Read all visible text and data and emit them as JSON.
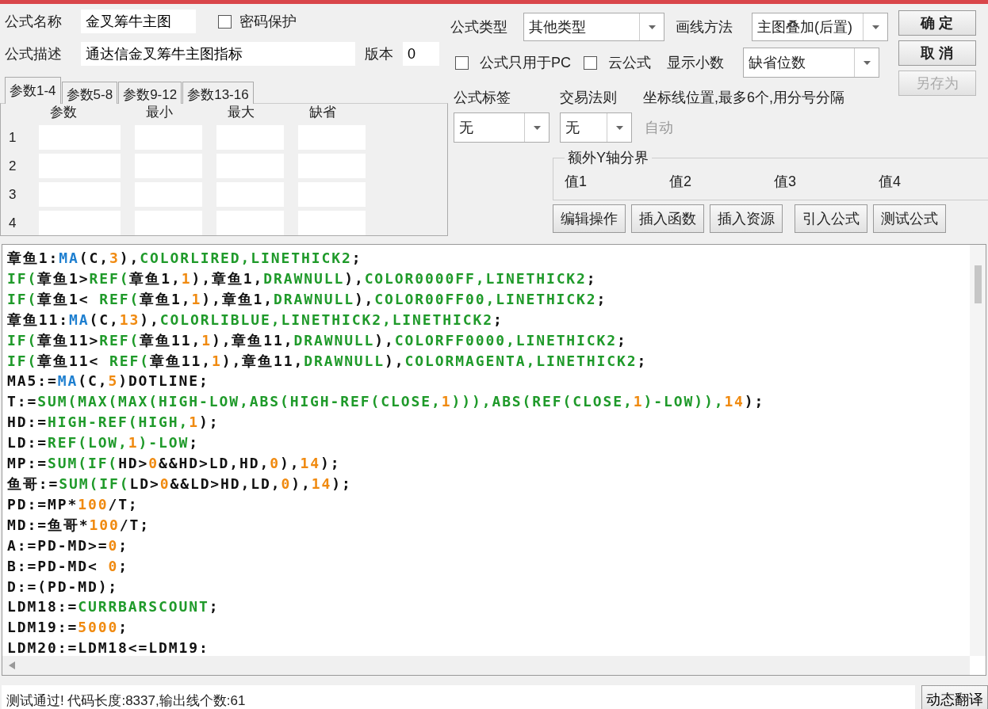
{
  "name_field": {
    "label": "公式名称",
    "value": "金叉筹牛主图"
  },
  "password_protect": {
    "label": "密码保护",
    "checked": false
  },
  "description_field": {
    "label": "公式描述",
    "value": "通达信金叉筹牛主图指标"
  },
  "version_field": {
    "label": "版本",
    "value": "0"
  },
  "param_tabs": [
    {
      "label": "参数1-4",
      "selected": true
    },
    {
      "label": "参数5-8",
      "selected": false
    },
    {
      "label": "参数9-12",
      "selected": false
    },
    {
      "label": "参数13-16",
      "selected": false
    }
  ],
  "param_table": {
    "columns": [
      "参数",
      "最小",
      "最大",
      "缺省"
    ],
    "rows": [
      "1",
      "2",
      "3",
      "4"
    ]
  },
  "formula_type": {
    "label": "公式类型",
    "value": "其他类型"
  },
  "draw_method": {
    "label": "画线方法",
    "value": "主图叠加(后置)"
  },
  "pc_only": {
    "label": "公式只用于PC",
    "checked": false
  },
  "cloud_formula": {
    "label": "云公式",
    "checked": false
  },
  "decimals": {
    "label": "显示小数",
    "value": "缺省位数"
  },
  "dialog_buttons": [
    {
      "label": "确 定",
      "disabled": false
    },
    {
      "label": "取 消",
      "disabled": false
    },
    {
      "label": "另存为",
      "disabled": true
    }
  ],
  "formula_tag": {
    "label": "公式标签",
    "value": "无"
  },
  "trade_rule": {
    "label": "交易法则",
    "value": "无"
  },
  "axis_positions": {
    "label": "坐标线位置,最多6个,用分号分隔",
    "placeholder": "自动"
  },
  "extra_y_axis": {
    "title": "额外Y轴分界",
    "values": [
      "值1",
      "值2",
      "值3",
      "值4"
    ]
  },
  "tool_buttons": [
    "编辑操作",
    "插入函数",
    "插入资源",
    "引入公式",
    "测试公式"
  ],
  "code_lines": [
    [
      {
        "kind": "plain",
        "text": "章鱼1:"
      },
      {
        "kind": "function",
        "text": "MA"
      },
      {
        "kind": "plain",
        "text": "(C,"
      },
      {
        "kind": "number",
        "text": "3"
      },
      {
        "kind": "plain",
        "text": "),"
      },
      {
        "kind": "keyword",
        "text": "COLORLIRED,LINETHICK2"
      },
      {
        "kind": "plain",
        "text": ";"
      }
    ],
    [
      {
        "kind": "keyword",
        "text": "IF("
      },
      {
        "kind": "plain",
        "text": "章鱼1>"
      },
      {
        "kind": "keyword",
        "text": "REF("
      },
      {
        "kind": "plain",
        "text": "章鱼1,"
      },
      {
        "kind": "number",
        "text": "1"
      },
      {
        "kind": "plain",
        "text": "),章鱼1,"
      },
      {
        "kind": "keyword",
        "text": "DRAWNULL"
      },
      {
        "kind": "plain",
        "text": "),"
      },
      {
        "kind": "keyword",
        "text": "COLOR0000FF,LINETHICK2"
      },
      {
        "kind": "plain",
        "text": ";"
      }
    ],
    [
      {
        "kind": "keyword",
        "text": "IF("
      },
      {
        "kind": "plain",
        "text": "章鱼1< "
      },
      {
        "kind": "keyword",
        "text": "REF("
      },
      {
        "kind": "plain",
        "text": "章鱼1,"
      },
      {
        "kind": "number",
        "text": "1"
      },
      {
        "kind": "plain",
        "text": "),章鱼1,"
      },
      {
        "kind": "keyword",
        "text": "DRAWNULL"
      },
      {
        "kind": "plain",
        "text": "),"
      },
      {
        "kind": "keyword",
        "text": "COLOR00FF00,LINETHICK2"
      },
      {
        "kind": "plain",
        "text": ";"
      }
    ],
    [
      {
        "kind": "plain",
        "text": "章鱼11:"
      },
      {
        "kind": "function",
        "text": "MA"
      },
      {
        "kind": "plain",
        "text": "(C,"
      },
      {
        "kind": "number",
        "text": "13"
      },
      {
        "kind": "plain",
        "text": "),"
      },
      {
        "kind": "keyword",
        "text": "COLORLIBLUE,LINETHICK2,LINETHICK2"
      },
      {
        "kind": "plain",
        "text": ";"
      }
    ],
    [
      {
        "kind": "keyword",
        "text": "IF("
      },
      {
        "kind": "plain",
        "text": "章鱼11>"
      },
      {
        "kind": "keyword",
        "text": "REF("
      },
      {
        "kind": "plain",
        "text": "章鱼11,"
      },
      {
        "kind": "number",
        "text": "1"
      },
      {
        "kind": "plain",
        "text": "),章鱼11,"
      },
      {
        "kind": "keyword",
        "text": "DRAWNULL"
      },
      {
        "kind": "plain",
        "text": "),"
      },
      {
        "kind": "keyword",
        "text": "COLORFF0000,LINETHICK2"
      },
      {
        "kind": "plain",
        "text": ";"
      }
    ],
    [
      {
        "kind": "keyword",
        "text": "IF("
      },
      {
        "kind": "plain",
        "text": "章鱼11< "
      },
      {
        "kind": "keyword",
        "text": "REF("
      },
      {
        "kind": "plain",
        "text": "章鱼11,"
      },
      {
        "kind": "number",
        "text": "1"
      },
      {
        "kind": "plain",
        "text": "),章鱼11,"
      },
      {
        "kind": "keyword",
        "text": "DRAWNULL"
      },
      {
        "kind": "plain",
        "text": "),"
      },
      {
        "kind": "keyword",
        "text": "COLORMAGENTA,LINETHICK2"
      },
      {
        "kind": "plain",
        "text": ";"
      }
    ],
    [
      {
        "kind": "plain",
        "text": "MA5:="
      },
      {
        "kind": "function",
        "text": "MA"
      },
      {
        "kind": "plain",
        "text": "(C,"
      },
      {
        "kind": "number",
        "text": "5"
      },
      {
        "kind": "plain",
        "text": ")DOTLINE;"
      }
    ],
    [
      {
        "kind": "plain",
        "text": "T:="
      },
      {
        "kind": "keyword",
        "text": "SUM(MAX(MAX(HIGH-LOW,ABS(HIGH-REF(CLOSE,"
      },
      {
        "kind": "number",
        "text": "1"
      },
      {
        "kind": "keyword",
        "text": "))),ABS(REF(CLOSE,"
      },
      {
        "kind": "number",
        "text": "1"
      },
      {
        "kind": "keyword",
        "text": ")-LOW)),"
      },
      {
        "kind": "number",
        "text": "14"
      },
      {
        "kind": "plain",
        "text": ");"
      }
    ],
    [
      {
        "kind": "plain",
        "text": "HD:="
      },
      {
        "kind": "keyword",
        "text": "HIGH-REF(HIGH,"
      },
      {
        "kind": "number",
        "text": "1"
      },
      {
        "kind": "plain",
        "text": ");"
      }
    ],
    [
      {
        "kind": "plain",
        "text": "LD:="
      },
      {
        "kind": "keyword",
        "text": "REF(LOW,"
      },
      {
        "kind": "number",
        "text": "1"
      },
      {
        "kind": "keyword",
        "text": ")-LOW"
      },
      {
        "kind": "plain",
        "text": ";"
      }
    ],
    [
      {
        "kind": "plain",
        "text": "MP:="
      },
      {
        "kind": "keyword",
        "text": "SUM(IF("
      },
      {
        "kind": "plain",
        "text": "HD>"
      },
      {
        "kind": "number",
        "text": "0"
      },
      {
        "kind": "plain",
        "text": "&&HD>LD,HD,"
      },
      {
        "kind": "number",
        "text": "0"
      },
      {
        "kind": "plain",
        "text": "),"
      },
      {
        "kind": "number",
        "text": "14"
      },
      {
        "kind": "plain",
        "text": ");"
      }
    ],
    [
      {
        "kind": "plain",
        "text": "鱼哥:="
      },
      {
        "kind": "keyword",
        "text": "SUM(IF("
      },
      {
        "kind": "plain",
        "text": "LD>"
      },
      {
        "kind": "number",
        "text": "0"
      },
      {
        "kind": "plain",
        "text": "&&LD>HD,LD,"
      },
      {
        "kind": "number",
        "text": "0"
      },
      {
        "kind": "plain",
        "text": "),"
      },
      {
        "kind": "number",
        "text": "14"
      },
      {
        "kind": "plain",
        "text": ");"
      }
    ],
    [
      {
        "kind": "plain",
        "text": "PD:=MP*"
      },
      {
        "kind": "number",
        "text": "100"
      },
      {
        "kind": "plain",
        "text": "/T;"
      }
    ],
    [
      {
        "kind": "plain",
        "text": "MD:=鱼哥*"
      },
      {
        "kind": "number",
        "text": "100"
      },
      {
        "kind": "plain",
        "text": "/T;"
      }
    ],
    [
      {
        "kind": "plain",
        "text": "A:=PD-MD>="
      },
      {
        "kind": "number",
        "text": "0"
      },
      {
        "kind": "plain",
        "text": ";"
      }
    ],
    [
      {
        "kind": "plain",
        "text": "B:=PD-MD< "
      },
      {
        "kind": "number",
        "text": "0"
      },
      {
        "kind": "plain",
        "text": ";"
      }
    ],
    [
      {
        "kind": "plain",
        "text": "D:=(PD-MD);"
      }
    ],
    [
      {
        "kind": "plain",
        "text": "LDM18:="
      },
      {
        "kind": "keyword",
        "text": "CURRBARSCOUNT"
      },
      {
        "kind": "plain",
        "text": ";"
      }
    ],
    [
      {
        "kind": "plain",
        "text": "LDM19:="
      },
      {
        "kind": "number",
        "text": "5000"
      },
      {
        "kind": "plain",
        "text": ";"
      }
    ],
    [
      {
        "kind": "plain",
        "text": "LDM20:=LDM18<=LDM19:"
      }
    ]
  ],
  "status_bar": {
    "message": "测试通过! 代码长度:8337,输出线个数:61",
    "button": "动态翻译"
  }
}
